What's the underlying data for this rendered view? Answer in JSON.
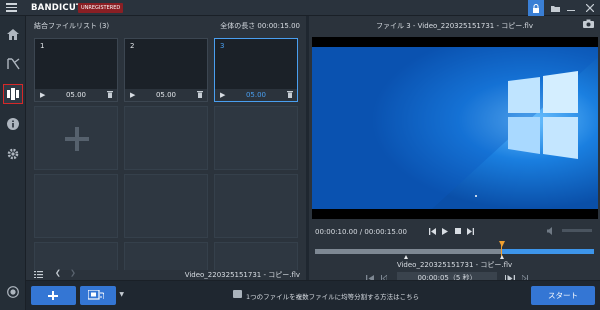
{
  "app": {
    "logo_bandi": "BANDI",
    "logo_cut": "CUT",
    "unregistered": "UNREGISTERED"
  },
  "colors": {
    "accent": "#3476d4",
    "highlight": "#4a9ff0",
    "marker": "#f0a030",
    "preview_bg": "#0f63c4",
    "sidebar_active_border": "#d62828"
  },
  "sidebar": {
    "items": [
      {
        "icon": "home-icon"
      },
      {
        "icon": "cut-icon"
      },
      {
        "icon": "join-icon",
        "active": true
      },
      {
        "icon": "info-icon"
      },
      {
        "icon": "gear-icon"
      },
      {
        "icon": "record-icon"
      }
    ]
  },
  "join_list": {
    "title": "結合ファイルリスト (3)",
    "total_length": "全体の長さ 00:00:15.00",
    "clips": [
      {
        "number": "1",
        "duration": "05.00",
        "selected": false
      },
      {
        "number": "2",
        "duration": "05.00",
        "selected": false
      },
      {
        "number": "3",
        "duration": "05.00",
        "selected": true
      }
    ],
    "footer_filename": "Video_220325151731 - コピー.flv"
  },
  "preview": {
    "title": "ファイル 3 - Video_220325151731 - コピー.flv",
    "time": "00:00:10.00 / 00:00:15.00",
    "progress": 0.67,
    "timeline_label": "Video_220325151731 - コピー.flv",
    "segment": "00:00:05（5 秒）"
  },
  "bottom": {
    "tip": "1つのファイルを複数ファイルに均等分割する方法はこちら",
    "start": "スタート"
  }
}
